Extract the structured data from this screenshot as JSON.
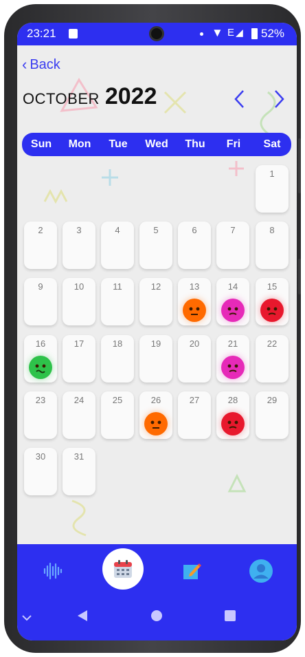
{
  "status": {
    "time": "23:21",
    "network": "E",
    "battery": "52%"
  },
  "header": {
    "back_label": "Back",
    "month": "OCTOBER",
    "year": "2022"
  },
  "weekdays": [
    "Sun",
    "Mon",
    "Tue",
    "Wed",
    "Thu",
    "Fri",
    "Sat"
  ],
  "days": [
    {
      "day": "1"
    },
    {
      "day": "2"
    },
    {
      "day": "3"
    },
    {
      "day": "4"
    },
    {
      "day": "5"
    },
    {
      "day": "6"
    },
    {
      "day": "7"
    },
    {
      "day": "8"
    },
    {
      "day": "9"
    },
    {
      "day": "10"
    },
    {
      "day": "11"
    },
    {
      "day": "12"
    },
    {
      "day": "13",
      "mood": "worried-face-icon",
      "color": "#ff6a00"
    },
    {
      "day": "14",
      "mood": "sad-blob-icon",
      "color": "#e62ab8"
    },
    {
      "day": "15",
      "mood": "angry-face-icon",
      "color": "#e8182d"
    },
    {
      "day": "16",
      "mood": "sick-face-icon",
      "color": "#2ec24a"
    },
    {
      "day": "17"
    },
    {
      "day": "18"
    },
    {
      "day": "19"
    },
    {
      "day": "20"
    },
    {
      "day": "21",
      "mood": "sad-blob-icon",
      "color": "#e62ab8"
    },
    {
      "day": "22"
    },
    {
      "day": "23"
    },
    {
      "day": "24"
    },
    {
      "day": "25"
    },
    {
      "day": "26",
      "mood": "worried-face-icon",
      "color": "#ff6a00"
    },
    {
      "day": "27"
    },
    {
      "day": "28",
      "mood": "frown-face-icon",
      "color": "#e8182d"
    },
    {
      "day": "29"
    },
    {
      "day": "30"
    },
    {
      "day": "31"
    }
  ],
  "first_weekday_index": 6,
  "bottom_nav": [
    "soundwave-icon",
    "calendar-icon",
    "journal-edit-icon",
    "profile-icon"
  ],
  "colors": {
    "accent": "#2d2ff0",
    "background": "#ededed"
  }
}
